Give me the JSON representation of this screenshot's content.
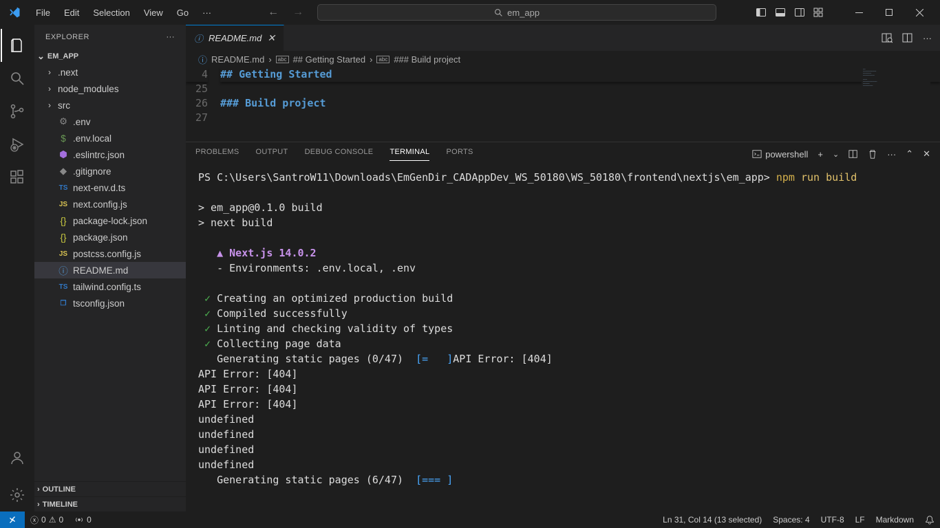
{
  "menu": {
    "file": "File",
    "edit": "Edit",
    "selection": "Selection",
    "view": "View",
    "go": "Go"
  },
  "search": {
    "text": "em_app"
  },
  "explorer": {
    "title": "EXPLORER",
    "project": "EM_APP",
    "folders": {
      "next": ".next",
      "node_modules": "node_modules",
      "src": "src"
    },
    "files": {
      "env": ".env",
      "env_local": ".env.local",
      "eslintrc": ".eslintrc.json",
      "gitignore": ".gitignore",
      "nextenv": "next-env.d.ts",
      "nextconfig": "next.config.js",
      "pkglock": "package-lock.json",
      "pkg": "package.json",
      "postcss": "postcss.config.js",
      "readme": "README.md",
      "tailwind": "tailwind.config.ts",
      "tsconfig": "tsconfig.json"
    },
    "outline": "OUTLINE",
    "timeline": "TIMELINE"
  },
  "tab": {
    "title": "README.md"
  },
  "breadcrumb": {
    "file": "README.md",
    "h2": "## Getting Started",
    "h3": "### Build project"
  },
  "code": {
    "l4": "4",
    "l25": "25",
    "l26": "26",
    "l27": "27",
    "h2": "## Getting Started",
    "h3": "### Build project"
  },
  "panel": {
    "problems": "PROBLEMS",
    "output": "OUTPUT",
    "debug": "DEBUG CONSOLE",
    "terminal": "TERMINAL",
    "ports": "PORTS",
    "shell": "powershell"
  },
  "term": {
    "prompt": "PS C:\\Users\\SantroW11\\Downloads\\EmGenDir_CADAppDev_WS_50180\\WS_50180\\frontend\\nextjs\\em_app> ",
    "cmd_npm": "npm",
    "cmd_rest": " run build",
    "build1": "> em_app@0.1.0 build",
    "build2": "> next build",
    "tri": "▲ ",
    "next": "Next.js 14.0.2",
    "env": "   - Environments: .env.local, .env",
    "c1": "Creating an optimized production build",
    "c2": "Compiled successfully",
    "c3": "Linting and checking validity of types",
    "c4": "Collecting page data",
    "gen0a": "   Generating static pages (0/47)  ",
    "gen0b": "[=   ]",
    "gen0c": "API Error: [404]",
    "api404": "API Error: [404]",
    "undef": "undefined",
    "gen6a": "   Generating static pages (6/47)  ",
    "gen6b": "[=== ]"
  },
  "status": {
    "errors": "0",
    "warnings": "0",
    "ports": "0",
    "cursor": "Ln 31, Col 14 (13 selected)",
    "spaces": "Spaces: 4",
    "encoding": "UTF-8",
    "eol": "LF",
    "lang": "Markdown"
  }
}
